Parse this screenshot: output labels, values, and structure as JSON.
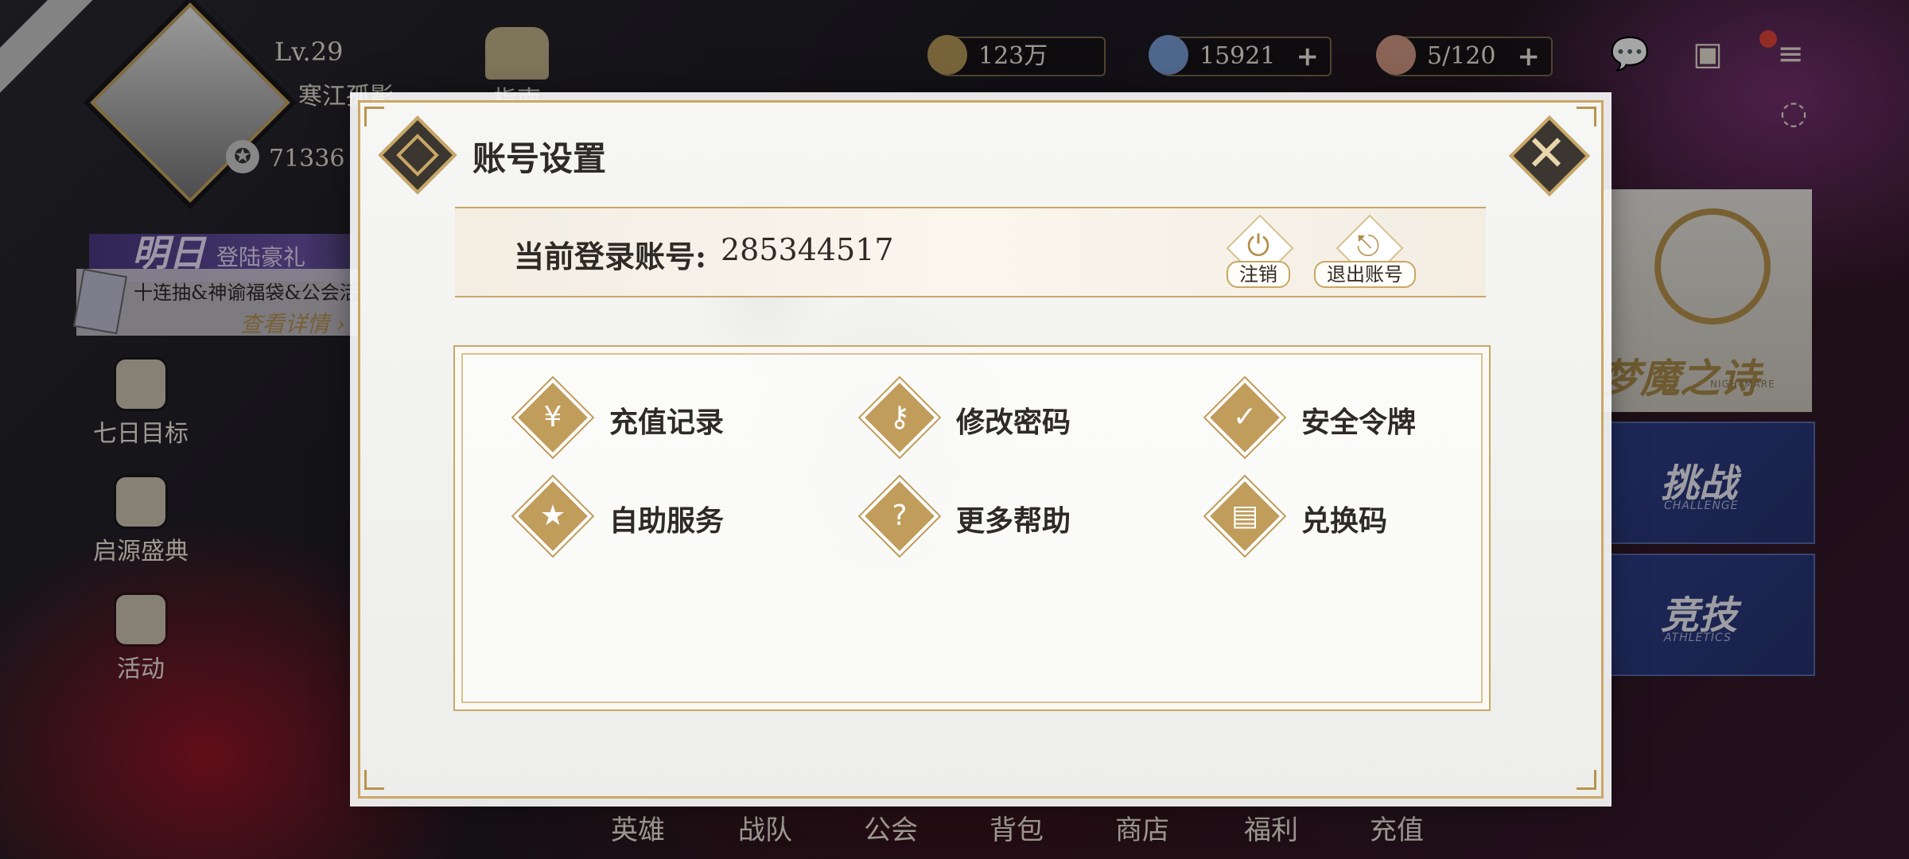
{
  "player": {
    "level": "Lv.29",
    "name": "寒江孤影",
    "power": "71336",
    "avatar_icon": "player-portrait"
  },
  "guide": {
    "label": "指南"
  },
  "promo": {
    "day": "明日",
    "title": "登陆豪礼",
    "desc": "十连抽&神谕福袋&公会活",
    "link": "查看详情 ›"
  },
  "side_menu": [
    {
      "label": "七日目标",
      "icon": "scroll-icon"
    },
    {
      "label": "启源盛典",
      "icon": "hat-icon"
    },
    {
      "label": "活动",
      "icon": "gift-bag-icon"
    }
  ],
  "resources": {
    "gold": {
      "value": "123万",
      "icon": "coin-icon"
    },
    "gems": {
      "value": "15921",
      "plus": "+",
      "icon": "gem-icon"
    },
    "stamina": {
      "value": "5/120",
      "plus": "+",
      "icon": "cake-icon"
    }
  },
  "top_icons": [
    "chat-icon",
    "card-icon",
    "menu-icon",
    "hide-icon"
  ],
  "right_panel": {
    "event_title": "梦魔之诗",
    "event_sub": "NIGHTMARE",
    "modes": [
      {
        "title": "挑战",
        "sub": "CHALLENGE"
      },
      {
        "title": "竞技",
        "sub": "ATHLETICS"
      }
    ]
  },
  "bottom_nav": [
    "英雄",
    "战队",
    "公会",
    "背包",
    "商店",
    "福利",
    "充值"
  ],
  "dialog": {
    "title": "账号设置",
    "account_label": "当前登录账号:",
    "account_id": "285344517",
    "actions": [
      {
        "label": "注销",
        "icon": "power-icon"
      },
      {
        "label": "退出账号",
        "icon": "logout-icon"
      }
    ],
    "options": [
      {
        "label": "充值记录",
        "icon": "yuan-icon",
        "glyph": "¥"
      },
      {
        "label": "修改密码",
        "icon": "key-icon",
        "glyph": "⚷"
      },
      {
        "label": "安全令牌",
        "icon": "shield-icon",
        "glyph": "✓"
      },
      {
        "label": "自助服务",
        "icon": "bookmark-icon",
        "glyph": "★"
      },
      {
        "label": "更多帮助",
        "icon": "help-icon",
        "glyph": "?"
      },
      {
        "label": "兑换码",
        "icon": "ticket-icon",
        "glyph": "▤"
      }
    ]
  },
  "colors": {
    "gold": "#c19d5c",
    "dark": "#3b3630",
    "dialog_bg": "#f3f3f2",
    "mode_blue": "#2e3f8a"
  }
}
